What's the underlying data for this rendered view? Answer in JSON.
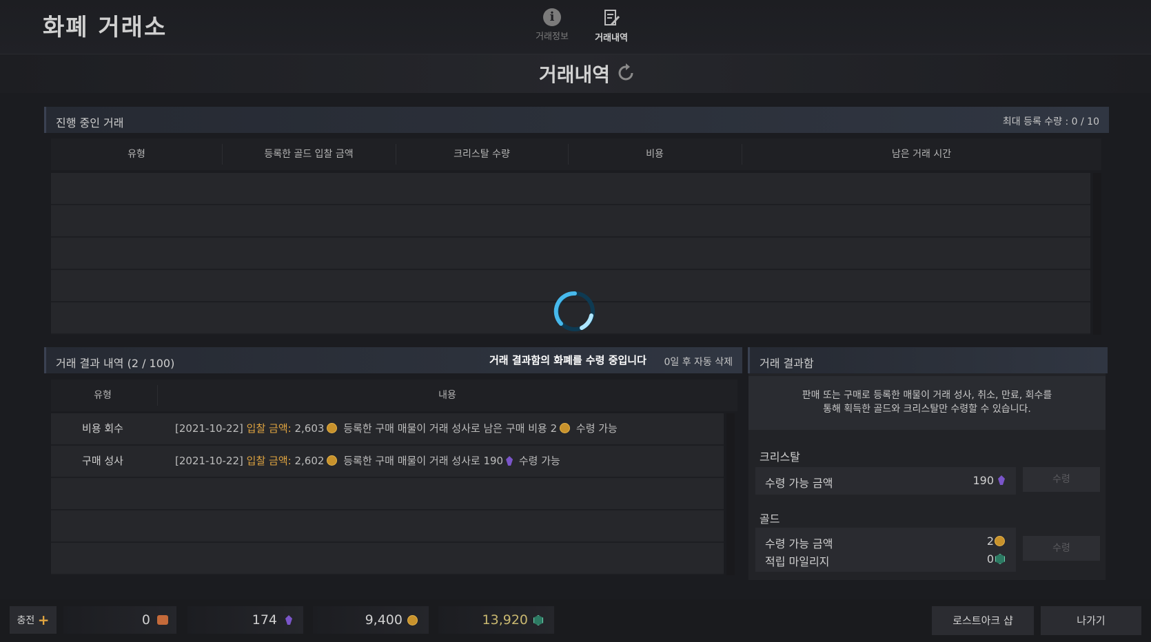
{
  "app_title": "화폐 거래소",
  "top_tabs": [
    {
      "label": "거래정보",
      "icon": "info-icon"
    },
    {
      "label": "거래내역",
      "icon": "document-edit-icon"
    }
  ],
  "page_title": "거래내역",
  "ongoing": {
    "title": "진행 중인 거래",
    "max_label": "최대 등록 수량 : 0 / 10",
    "columns": [
      "유형",
      "등록한 골드 입찰 금액",
      "크리스탈 수량",
      "비용",
      "남은 거래 시간"
    ]
  },
  "results": {
    "title": "거래 결과 내역 (2 / 100)",
    "auto_delete": "0일 후 자동 삭제",
    "columns": [
      "유형",
      "내용"
    ],
    "rows": [
      {
        "type": "비용 회수",
        "date": "[2021-10-22]",
        "bid_label": "입찰 금액:",
        "bid": "2,603",
        "text": "등록한 구매 매물이 거래 성사로 남은 구매 비용 2",
        "suffix": "수령 가능"
      },
      {
        "type": "구매 성사",
        "date": "[2021-10-22]",
        "bid_label": "입찰 금액:",
        "bid": "2,602",
        "text": "등록한 구매 매물이 거래 성사로 190",
        "suffix": "수령 가능"
      }
    ]
  },
  "toast": "거래 결과함의 화폐를 수령 중입니다",
  "result_box": {
    "title": "거래 결과함",
    "desc_line1": "판매 또는 구매로 등록한 매물이 거래 성사, 취소, 만료, 회수를",
    "desc_line2": "통해 획득한 골드와 크리스탈만 수령할 수 있습니다.",
    "crystal_section": "크리스탈",
    "crystal_label": "수령 가능 금액",
    "crystal_value": "190",
    "gold_section": "골드",
    "gold_label": "수령 가능 금액",
    "gold_value": "2",
    "mileage_label": "적립 마일리지",
    "mileage_value": "0",
    "receive_label": "수령"
  },
  "bottom": {
    "charge_label": "충전",
    "charge_plus": "+",
    "currencies": [
      {
        "value": "0",
        "icon": "royal-crystal-icon"
      },
      {
        "value": "174",
        "icon": "crystal-icon"
      },
      {
        "value": "9,400",
        "icon": "gold-icon"
      },
      {
        "value": "13,920",
        "icon": "mileage-icon"
      }
    ],
    "shop_label": "로스트아크 샵",
    "exit_label": "나가기"
  },
  "colors": {
    "highlight": "#e0a440",
    "gold": "#c8922c",
    "crystal": "#7a55c9",
    "mileage": "#2d7a63"
  }
}
